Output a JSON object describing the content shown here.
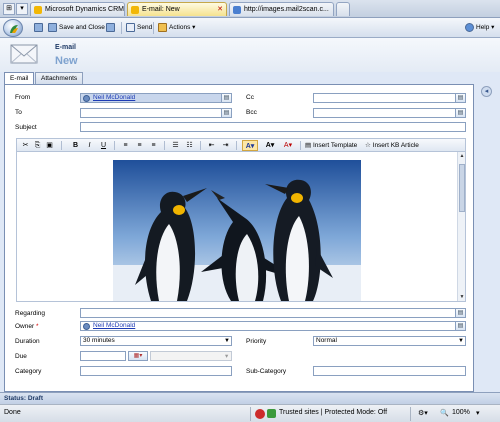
{
  "browser": {
    "tabs": [
      {
        "label": "Microsoft Dynamics CRM",
        "active": false
      },
      {
        "label": "E-mail: New",
        "active": true
      },
      {
        "label": "http://images.mail2scan.c...",
        "active": false
      }
    ]
  },
  "toolbar": {
    "save_and_close": "Save and Close",
    "send": "Send",
    "actions": "Actions",
    "help": "Help"
  },
  "header": {
    "entity_type": "E-mail",
    "record_name": "New"
  },
  "form_tabs": [
    "E-mail",
    "Attachments"
  ],
  "fields": {
    "from_label": "From",
    "from_value": "Neil McDonald",
    "to_label": "To",
    "cc_label": "Cc",
    "bcc_label": "Bcc",
    "subject_label": "Subject",
    "regarding_label": "Regarding",
    "owner_label": "Owner",
    "owner_required": "*",
    "owner_value": "Neil McDonald",
    "duration_label": "Duration",
    "duration_value": "30 minutes",
    "priority_label": "Priority",
    "priority_value": "Normal",
    "due_label": "Due",
    "category_label": "Category",
    "subcategory_label": "Sub-Category"
  },
  "editor_toolbar": {
    "bold": "B",
    "italic": "I",
    "underline": "U",
    "insert_template": "Insert Template",
    "insert_kb_article": "Insert KB Article"
  },
  "form_status": "Status: Draft",
  "ie_status": {
    "left": "Done",
    "zone": "Trusted sites | Protected Mode: Off",
    "zoom": "100%"
  },
  "colors": {
    "active_tab": "#f5e28f",
    "link": "#1d3bb5",
    "header_title": "#7ea2cf"
  }
}
